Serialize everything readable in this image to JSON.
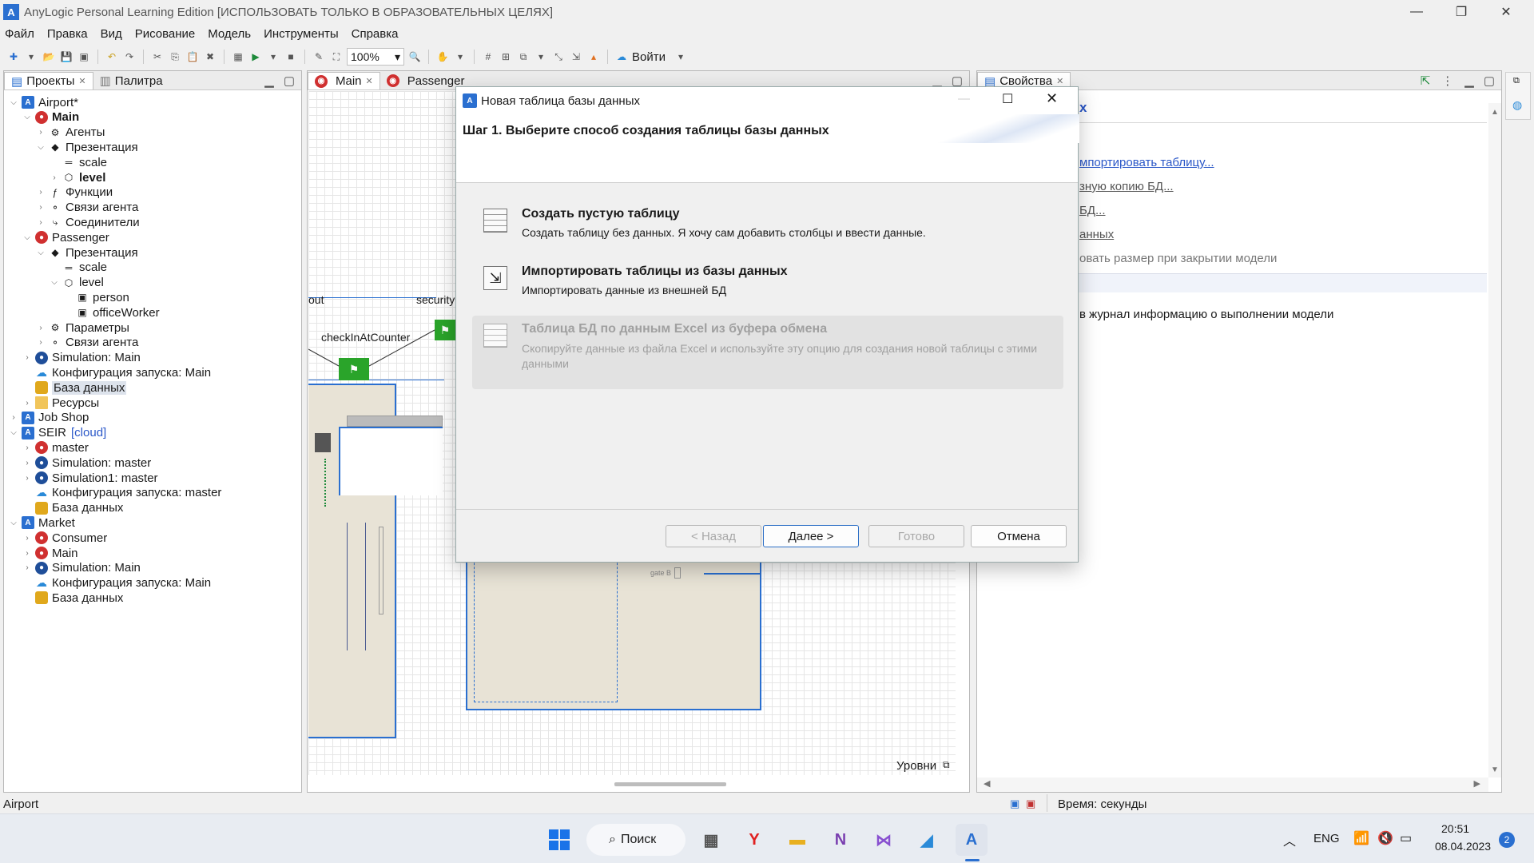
{
  "window": {
    "title": "AnyLogic Personal Learning Edition [ИСПОЛЬЗОВАТЬ ТОЛЬКО В ОБРАЗОВАТЕЛЬНЫХ ЦЕЛЯХ]"
  },
  "menu": [
    "Файл",
    "Правка",
    "Вид",
    "Рисование",
    "Модель",
    "Инструменты",
    "Справка"
  ],
  "toolbar": {
    "zoom": "100%",
    "login": "Войти"
  },
  "left_panel": {
    "tabs": [
      "Проекты",
      "Палитра"
    ],
    "tree": [
      {
        "label": "Airport*",
        "level": 0,
        "twisty": "v",
        "icon": "project"
      },
      {
        "label": "Main",
        "level": 1,
        "twisty": "v",
        "icon": "agent",
        "bold": true
      },
      {
        "label": "Агенты",
        "level": 2,
        "twisty": ">",
        "icon": "agents"
      },
      {
        "label": "Презентация",
        "level": 2,
        "twisty": "v",
        "icon": "presentation"
      },
      {
        "label": "scale",
        "level": 3,
        "twisty": "",
        "icon": "scale"
      },
      {
        "label": "level",
        "level": 3,
        "twisty": ">",
        "icon": "level",
        "bold": true
      },
      {
        "label": "Функции",
        "level": 2,
        "twisty": ">",
        "icon": "functions"
      },
      {
        "label": "Связи агента",
        "level": 2,
        "twisty": ">",
        "icon": "links"
      },
      {
        "label": "Соединители",
        "level": 2,
        "twisty": ">",
        "icon": "connectors"
      },
      {
        "label": "Passenger",
        "level": 1,
        "twisty": "v",
        "icon": "agent"
      },
      {
        "label": "Презентация",
        "level": 2,
        "twisty": "v",
        "icon": "presentation"
      },
      {
        "label": "scale",
        "level": 3,
        "twisty": "",
        "icon": "scale"
      },
      {
        "label": "level",
        "level": 3,
        "twisty": "v",
        "icon": "level"
      },
      {
        "label": "person",
        "level": 4,
        "twisty": "",
        "icon": "shape"
      },
      {
        "label": "officeWorker",
        "level": 4,
        "twisty": "",
        "icon": "shape"
      },
      {
        "label": "Параметры",
        "level": 2,
        "twisty": ">",
        "icon": "params"
      },
      {
        "label": "Связи агента",
        "level": 2,
        "twisty": ">",
        "icon": "links"
      },
      {
        "label": "Simulation: Main",
        "level": 1,
        "twisty": ">",
        "icon": "simulation"
      },
      {
        "label": "Конфигурация запуска: Main",
        "level": 1,
        "twisty": "",
        "icon": "cloud"
      },
      {
        "label": "База данных",
        "level": 1,
        "twisty": "",
        "icon": "database",
        "selected": true
      },
      {
        "label": "Ресурсы",
        "level": 1,
        "twisty": ">",
        "icon": "folder"
      },
      {
        "label": "Job Shop",
        "level": 0,
        "twisty": ">",
        "icon": "project"
      },
      {
        "label": "SEIR",
        "suffix": "[cloud]",
        "level": 0,
        "twisty": "v",
        "icon": "project"
      },
      {
        "label": "master",
        "level": 1,
        "twisty": ">",
        "icon": "agent"
      },
      {
        "label": "Simulation: master",
        "level": 1,
        "twisty": ">",
        "icon": "simulation"
      },
      {
        "label": "Simulation1: master",
        "level": 1,
        "twisty": ">",
        "icon": "simulation"
      },
      {
        "label": "Конфигурация запуска: master",
        "level": 1,
        "twisty": "",
        "icon": "cloud"
      },
      {
        "label": "База данных",
        "level": 1,
        "twisty": "",
        "icon": "database"
      },
      {
        "label": "Market",
        "level": 0,
        "twisty": "v",
        "icon": "project"
      },
      {
        "label": "Consumer",
        "level": 1,
        "twisty": ">",
        "icon": "agent"
      },
      {
        "label": "Main",
        "level": 1,
        "twisty": ">",
        "icon": "agent"
      },
      {
        "label": "Simulation: Main",
        "level": 1,
        "twisty": ">",
        "icon": "simulation"
      },
      {
        "label": "Конфигурация запуска: Main",
        "level": 1,
        "twisty": "",
        "icon": "cloud"
      },
      {
        "label": "База данных",
        "level": 1,
        "twisty": "",
        "icon": "database"
      }
    ]
  },
  "editor": {
    "tabs": [
      "Main",
      "Passenger"
    ],
    "labels": {
      "out": "out",
      "security": "security",
      "checkin": "checkInAtCounter",
      "gate": "gate B"
    },
    "levels_label": "Уровни"
  },
  "properties": {
    "tab": "Свойства",
    "header_tail": "х",
    "links": [
      "мпортировать таблицу...",
      "зную копию БД...",
      "БД...",
      "анных"
    ],
    "text1": "овать размер при закрытии модели",
    "text2": "в журнал информацию о выполнении модели"
  },
  "dialog": {
    "title": "Новая таблица базы данных",
    "heading": "Шаг 1. Выберите способ создания таблицы базы данных",
    "options": [
      {
        "title": "Создать пустую таблицу",
        "desc": "Создать таблицу без данных. Я хочу сам добавить столбцы и ввести данные.",
        "enabled": true
      },
      {
        "title": "Импортировать таблицы из базы данных",
        "desc": "Импортировать данные из внешней БД",
        "enabled": true
      },
      {
        "title": "Таблица БД по данным Excel из буфера обмена",
        "desc": "Скопируйте данные из файла Excel и используйте эту опцию для создания новой таблицы с этими данными",
        "enabled": false
      }
    ],
    "buttons": {
      "back": "< Назад",
      "next": "Далее >",
      "finish": "Готово",
      "cancel": "Отмена"
    }
  },
  "status": {
    "left": "Airport",
    "time_unit": "Время: секунды"
  },
  "taskbar": {
    "search": "Поиск",
    "lang": "ENG",
    "time": "20:51",
    "date": "08.04.2023",
    "badge": "2"
  }
}
